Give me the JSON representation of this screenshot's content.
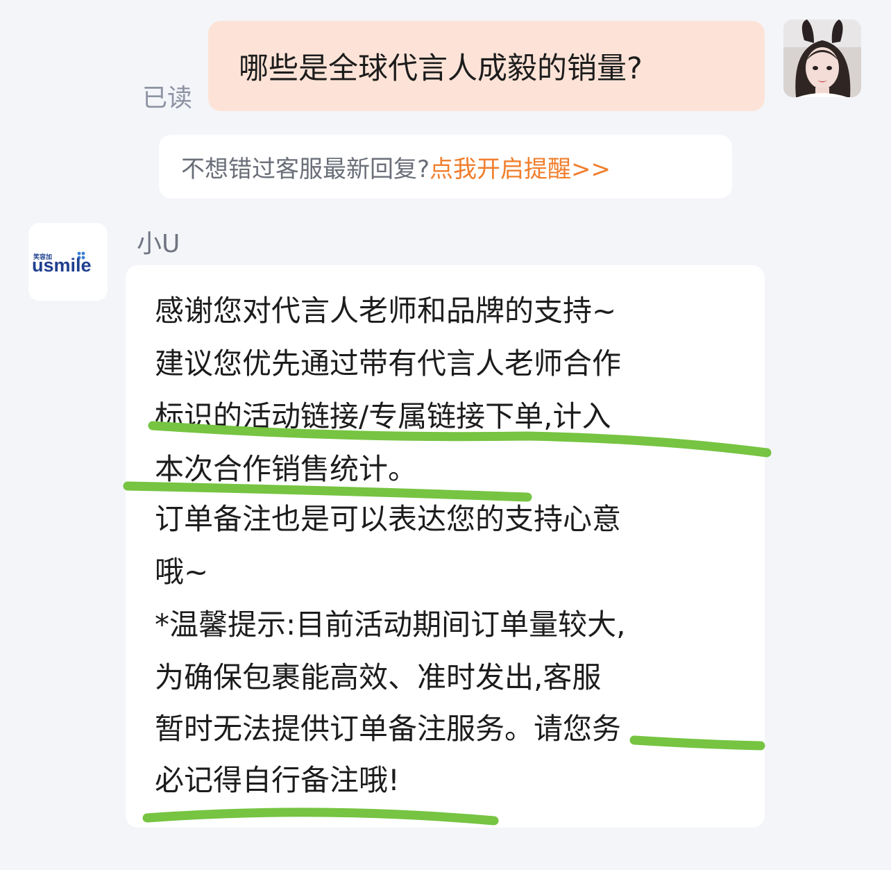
{
  "user_message": {
    "text": "哪些是全球代言人成毅的销量?",
    "read_status": "已读"
  },
  "reminder": {
    "text": "不想错过客服最新回复?",
    "link": "点我开启提醒>>"
  },
  "agent": {
    "name": "小U",
    "logo_small_text": "笑容加",
    "logo_text": "usmile",
    "lines": [
      "感谢您对代言人老师和品牌的支持~",
      "建议您优先通过带有代言人老师合作",
      "标识的活动链接/专属链接下单,计入",
      "本次合作销售统计。",
      "订单备注也是可以表达您的支持心意",
      "哦~",
      "*温馨提示:目前活动期间订单量较大,",
      "为确保包裹能高效、准时发出,客服",
      "暂时无法提供订单备注服务。请您务",
      "必记得自行备注哦!"
    ]
  },
  "colors": {
    "background": "#f4f5f9",
    "user_bubble": "#fde3d7",
    "agent_bubble": "#ffffff",
    "link": "#f07e2c",
    "highlight_underline": "#76c442"
  }
}
